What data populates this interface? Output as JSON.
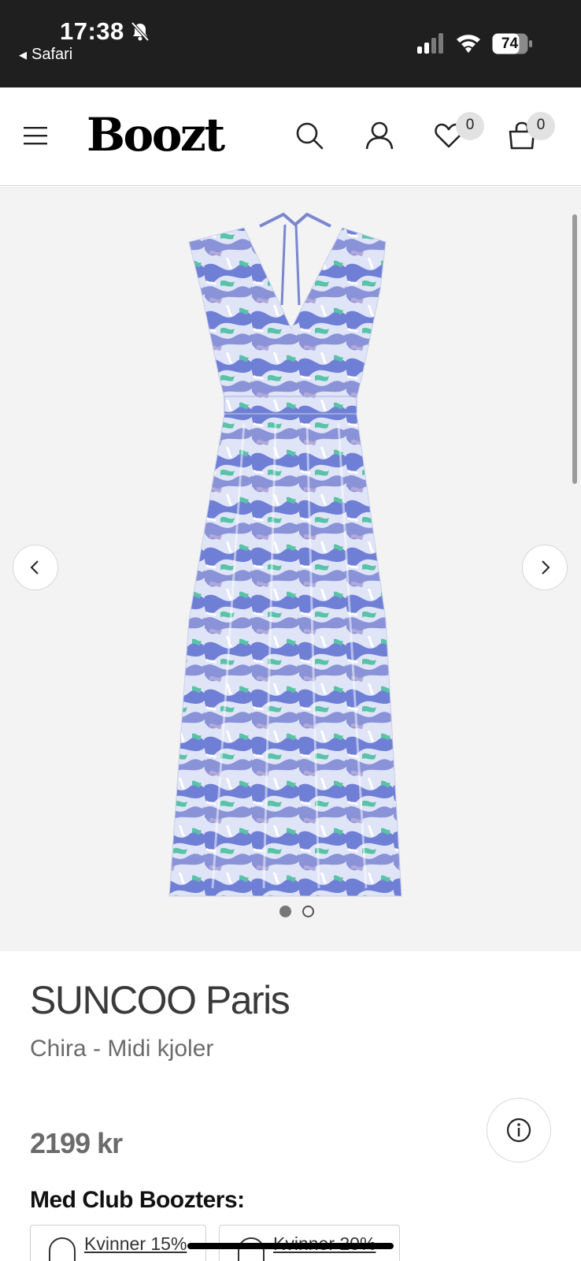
{
  "status_bar": {
    "time": "17:38",
    "back_label": "Safari",
    "battery": "74",
    "icons": [
      "bell-slash-icon",
      "signal-icon",
      "wifi-icon",
      "battery-icon"
    ]
  },
  "header": {
    "logo": "Boozt",
    "wishlist_count": "0",
    "cart_count": "0",
    "icons": [
      "menu-icon",
      "search-icon",
      "user-icon",
      "heart-icon",
      "shopping-bag-icon"
    ]
  },
  "gallery": {
    "image_alt": "Blue and white printed midi dress",
    "image_count": 2,
    "current_index": 1,
    "colors": {
      "background": "#f3f3f3",
      "dress_primary": "#6f7fd6",
      "dress_accent": "#58c3a6"
    }
  },
  "product": {
    "brand": "SUNCOO Paris",
    "subtitle": "Chira - Midi kjoler",
    "price": "2199 kr",
    "club_heading": "Med Club Boozters:",
    "discounts": [
      {
        "label": "Kvinner 15%"
      },
      {
        "label": "Kvinner 20%"
      }
    ]
  }
}
